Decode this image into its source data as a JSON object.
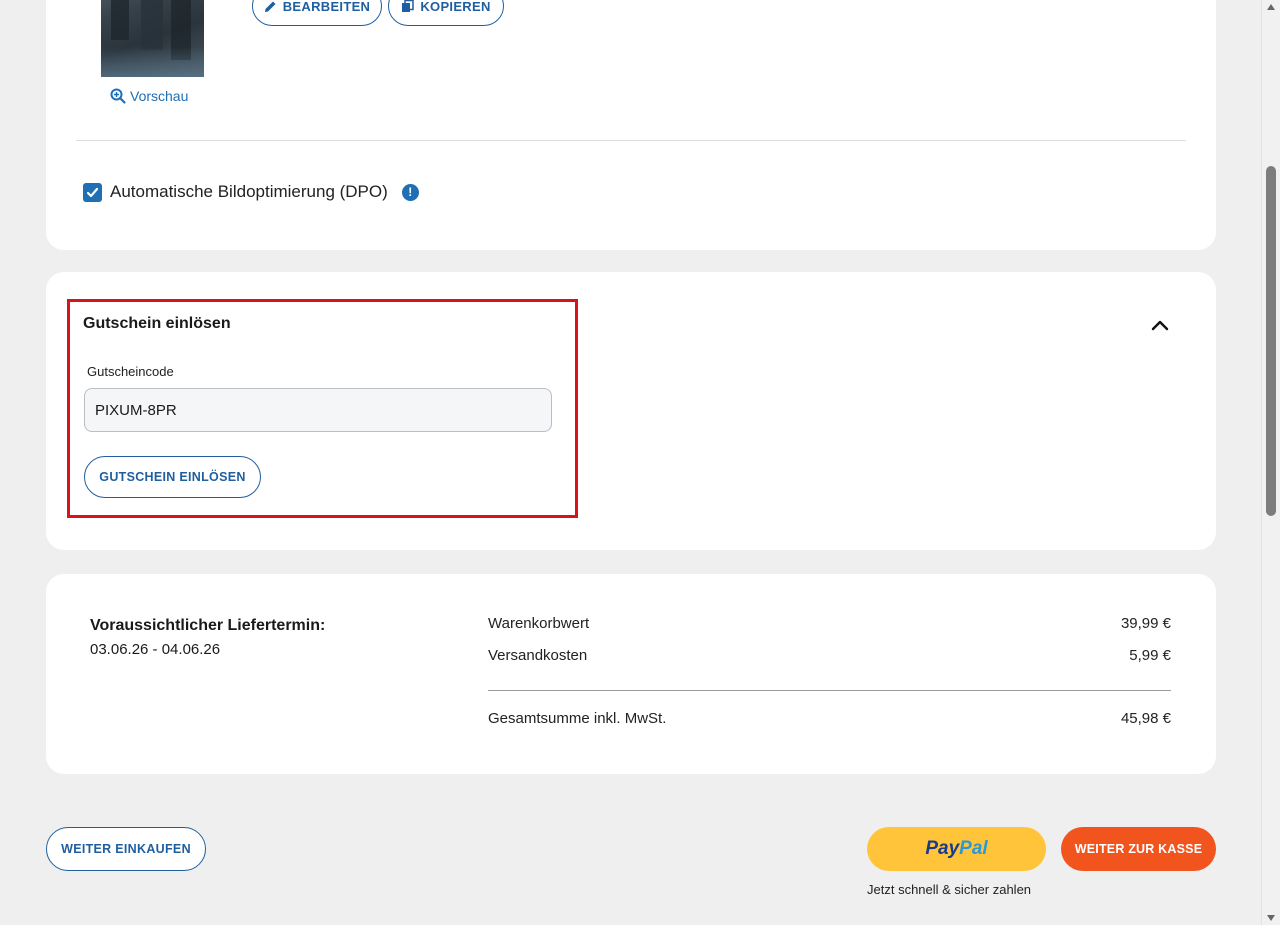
{
  "item": {
    "preview_label": "Vorschau",
    "edit_label": "BEARBEITEN",
    "copy_label": "KOPIEREN",
    "dpo_label": "Automatische Bildoptimierung (DPO)",
    "dpo_checked": true,
    "info_icon_text": "!"
  },
  "coupon": {
    "title": "Gutschein einlösen",
    "field_label": "Gutscheincode",
    "code_value": "PIXUM-8PR",
    "button_label": "GUTSCHEIN EINLÖSEN",
    "expanded": true
  },
  "summary": {
    "delivery_title": "Voraussichtlicher Liefertermin:",
    "delivery_date": "03.06.26 - 04.06.26",
    "rows": [
      {
        "label": "Warenkorbwert",
        "value": "39,99 €"
      },
      {
        "label": "Versandkosten",
        "value": "5,99 €"
      },
      {
        "label": "Gesamtsumme inkl. MwSt.",
        "value": "45,98 €"
      }
    ]
  },
  "actions": {
    "continue_label": "WEITER EINKAUFEN",
    "paypal_pay": "Pay",
    "paypal_pal": "Pal",
    "paypal_sub": "Jetzt schnell & sicher zahlen",
    "checkout_label": "WEITER ZUR KASSE"
  },
  "colors": {
    "accent": "#1f6fb5",
    "highlight": "#d8141b",
    "paypal": "#ffc43a",
    "checkout": "#f2541d",
    "background": "#efefef"
  }
}
